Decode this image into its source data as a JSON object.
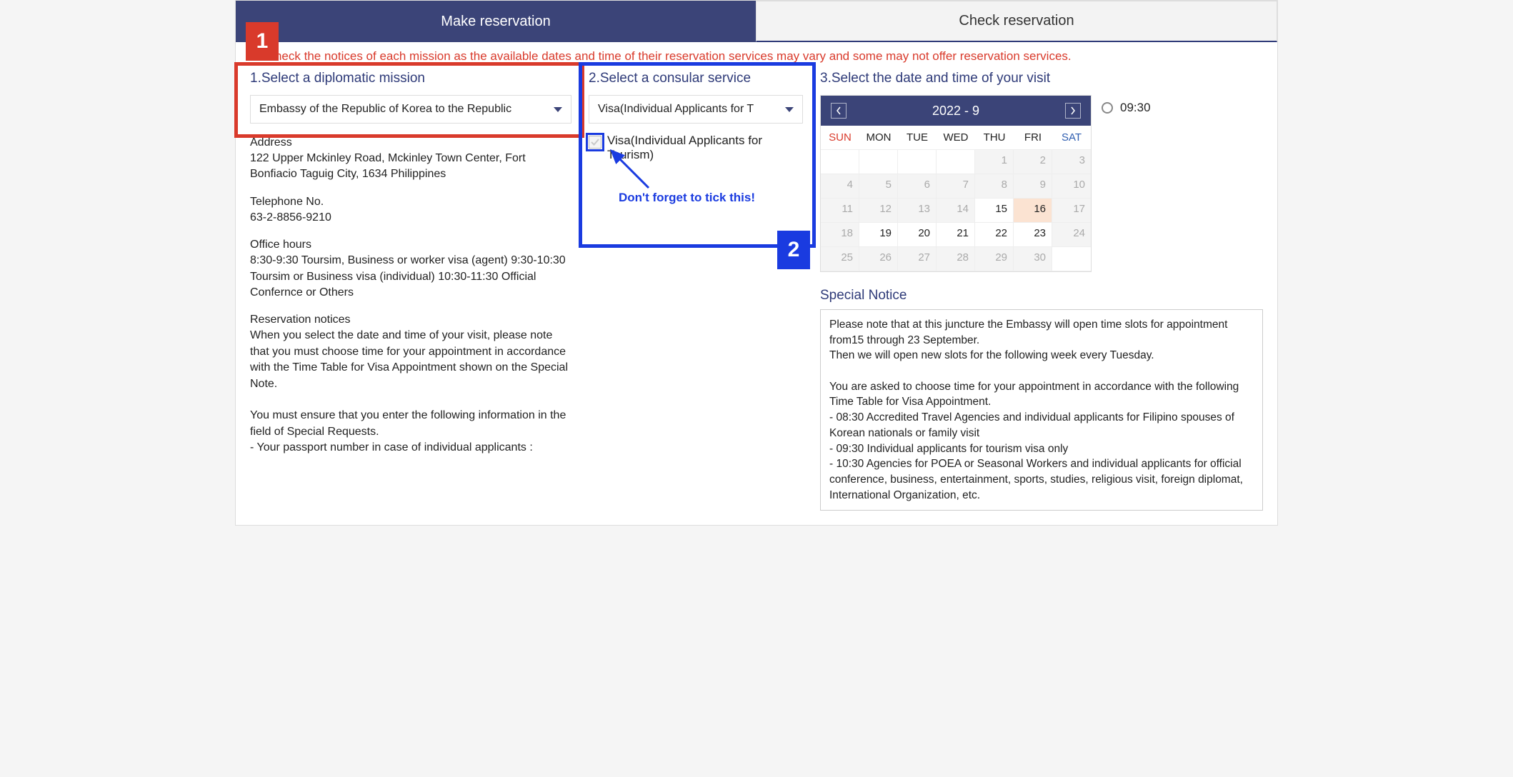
{
  "tabs": {
    "make": "Make reservation",
    "check": "Check reservation"
  },
  "top_notice": "check the notices of each mission as the available dates and time of their reservation services may vary and some may not offer reservation services.",
  "annotations": {
    "badge1": "1",
    "badge2": "2",
    "tick_hint": "Don't forget to tick this!"
  },
  "step1": {
    "title": "1.Select a diplomatic mission",
    "selected": "Embassy of the Republic of Korea to the Republic",
    "address_label": "Address",
    "address": "122 Upper Mckinley Road, Mckinley Town Center, Fort Bonfiacio Taguig City, 1634 Philippines",
    "phone_label": "Telephone No.",
    "phone": "63-2-8856-9210",
    "hours_label": "Office hours",
    "hours": "8:30-9:30 Toursim, Business or worker visa (agent) 9:30-10:30 Toursim or Business visa (individual) 10:30-11:30 Official Confernce or Others",
    "res_notices_label": "Reservation notices",
    "res_notices": "When you select the date and time of your visit, please note that you must choose time for your appointment in accordance with the Time Table for Visa Appointment shown on the Special Note.\n\nYou must ensure that you enter the following information in the field of Special Requests.\n- Your passport number in case of individual applicants :"
  },
  "step2": {
    "title": "2.Select a consular service",
    "selected": "Visa(Individual Applicants for T",
    "option1": "Visa(Individual Applicants for Tourism)"
  },
  "step3": {
    "title": "3.Select the date and time of your visit",
    "month_label": "2022 - 9",
    "dow": [
      "SUN",
      "MON",
      "TUE",
      "WED",
      "THU",
      "FRI",
      "SAT"
    ],
    "cells": [
      {
        "d": "",
        "s": "empty"
      },
      {
        "d": "",
        "s": "empty"
      },
      {
        "d": "",
        "s": "empty"
      },
      {
        "d": "",
        "s": "empty"
      },
      {
        "d": "1",
        "s": "disabled"
      },
      {
        "d": "2",
        "s": "disabled"
      },
      {
        "d": "3",
        "s": "disabled"
      },
      {
        "d": "4",
        "s": "disabled"
      },
      {
        "d": "5",
        "s": "disabled"
      },
      {
        "d": "6",
        "s": "disabled"
      },
      {
        "d": "7",
        "s": "disabled"
      },
      {
        "d": "8",
        "s": "disabled"
      },
      {
        "d": "9",
        "s": "disabled"
      },
      {
        "d": "10",
        "s": "disabled"
      },
      {
        "d": "11",
        "s": "disabled"
      },
      {
        "d": "12",
        "s": "disabled"
      },
      {
        "d": "13",
        "s": "disabled"
      },
      {
        "d": "14",
        "s": "disabled"
      },
      {
        "d": "15",
        "s": "available"
      },
      {
        "d": "16",
        "s": "selected"
      },
      {
        "d": "17",
        "s": "disabled"
      },
      {
        "d": "18",
        "s": "disabled"
      },
      {
        "d": "19",
        "s": "available"
      },
      {
        "d": "20",
        "s": "available"
      },
      {
        "d": "21",
        "s": "available"
      },
      {
        "d": "22",
        "s": "available"
      },
      {
        "d": "23",
        "s": "available"
      },
      {
        "d": "24",
        "s": "disabled"
      },
      {
        "d": "25",
        "s": "disabled"
      },
      {
        "d": "26",
        "s": "disabled"
      },
      {
        "d": "27",
        "s": "disabled"
      },
      {
        "d": "28",
        "s": "disabled"
      },
      {
        "d": "29",
        "s": "disabled"
      },
      {
        "d": "30",
        "s": "disabled"
      },
      {
        "d": "",
        "s": "empty"
      }
    ],
    "timeslot1": "09:30",
    "special_title": "Special Notice",
    "special_body": "Please note that at this juncture the Embassy will open time slots for appointment from15 through 23 September.\nThen we will open new slots for the following week every Tuesday.\n\nYou are asked to choose time for your appointment in accordance with the following Time Table for Visa Appointment.\n- 08:30   Accredited Travel Agencies and individual applicants for Filipino spouses of Korean nationals or family visit\n- 09:30   Individual applicants for tourism visa only\n- 10:30   Agencies for POEA or Seasonal Workers and individual applicants for official conference, business, entertainment, sports, studies, religious visit, foreign diplomat, International Organization, etc."
  }
}
